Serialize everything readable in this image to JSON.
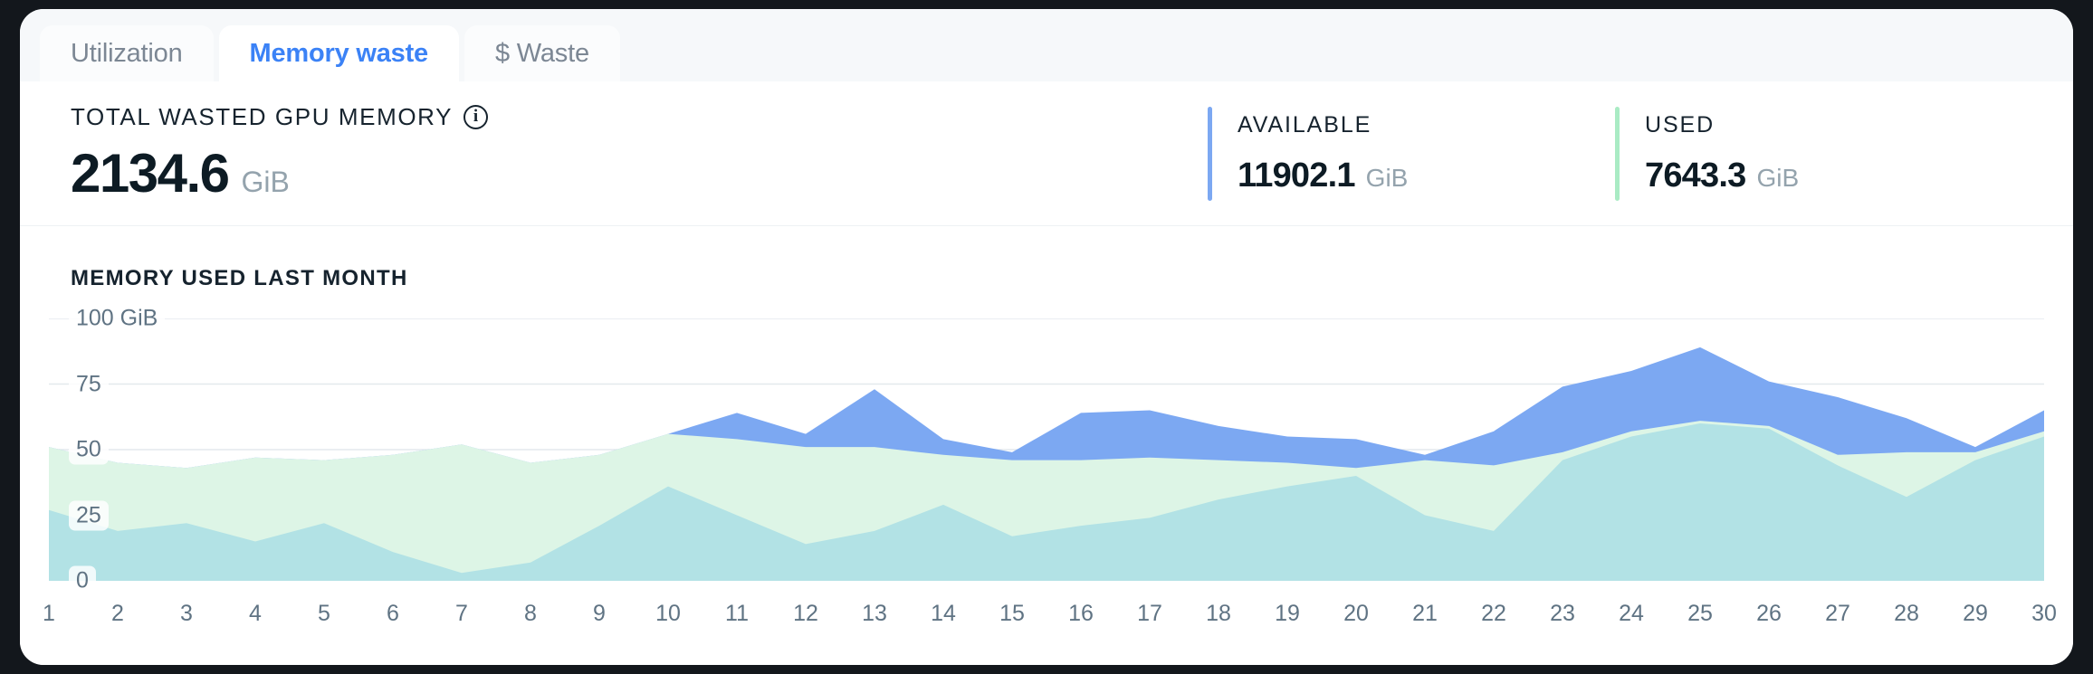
{
  "tabs": [
    {
      "label": "Utilization",
      "active": false
    },
    {
      "label": "Memory waste",
      "active": true
    },
    {
      "label": "$ Waste",
      "active": false
    }
  ],
  "primary_stat": {
    "label": "TOTAL WASTED GPU MEMORY",
    "value": "2134.6",
    "unit": "GiB",
    "info_icon": "info-icon",
    "info_glyph": "i"
  },
  "side_stats": [
    {
      "label": "AVAILABLE",
      "value": "11902.1",
      "unit": "GiB",
      "accent": "#7CA8F2"
    },
    {
      "label": "USED",
      "value": "7643.3",
      "unit": "GiB",
      "accent": "#A9EBC4"
    }
  ],
  "colors": {
    "accent_blue": "#7CA8F2",
    "accent_green": "#A9EBC4",
    "series_used": "#B2E2E5",
    "series_available": "#DDF5E6",
    "series_waste": "#7CA8F2",
    "tab_active_text": "#3B82F6",
    "grid": "#E4E9ED",
    "tick_text": "#5F7383"
  },
  "chart_data": {
    "type": "area",
    "stacked": true,
    "title": "MEMORY USED LAST MONTH",
    "xlabel": "",
    "ylabel": "",
    "ylim": [
      0,
      100
    ],
    "yticks": [
      0,
      25,
      50,
      75,
      100
    ],
    "ytick_labels": [
      "0",
      "25",
      "50",
      "75",
      "100 GiB"
    ],
    "grid": true,
    "legend": "none",
    "unit": "GiB",
    "categories": [
      1,
      2,
      3,
      4,
      5,
      6,
      7,
      8,
      9,
      10,
      11,
      12,
      13,
      14,
      15,
      16,
      17,
      18,
      19,
      20,
      21,
      22,
      23,
      24,
      25,
      26,
      27,
      28,
      29,
      30
    ],
    "series": [
      {
        "name": "Used",
        "color": "#B2E2E5",
        "values": [
          27,
          19,
          22,
          15,
          22,
          11,
          3,
          7,
          21,
          36,
          25,
          14,
          19,
          29,
          17,
          21,
          24,
          31,
          36,
          40,
          25,
          19,
          46,
          55,
          60,
          58,
          44,
          32,
          46,
          55
        ]
      },
      {
        "name": "Available",
        "color": "#DDF5E6",
        "values": [
          24,
          26,
          21,
          32,
          24,
          37,
          49,
          38,
          27,
          20,
          29,
          37,
          32,
          19,
          29,
          25,
          23,
          15,
          9,
          3,
          21,
          25,
          3,
          2,
          1,
          1,
          4,
          17,
          3,
          2
        ]
      },
      {
        "name": "Waste",
        "color": "#7CA8F2",
        "values": [
          0,
          0,
          0,
          0,
          0,
          0,
          0,
          0,
          0,
          0,
          10,
          5,
          22,
          6,
          3,
          18,
          18,
          13,
          10,
          11,
          2,
          13,
          25,
          23,
          28,
          17,
          22,
          13,
          2,
          8
        ]
      }
    ],
    "x_tick_labels": [
      "1",
      "2",
      "3",
      "4",
      "5",
      "6",
      "7",
      "8",
      "9",
      "10",
      "11",
      "12",
      "13",
      "14",
      "15",
      "16",
      "17",
      "18",
      "19",
      "20",
      "21",
      "22",
      "23",
      "24",
      "25",
      "26",
      "27",
      "28",
      "29",
      "30"
    ]
  }
}
